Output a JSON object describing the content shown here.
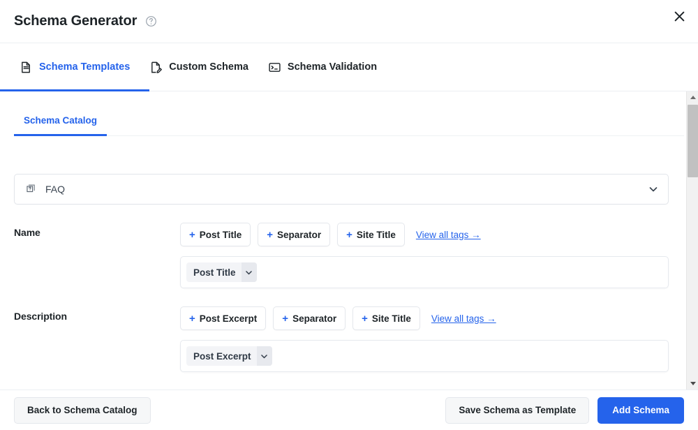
{
  "header": {
    "title": "Schema Generator",
    "help_icon": "question-circle-icon",
    "close_icon": "close-icon"
  },
  "tabs": [
    {
      "label": "Schema Templates",
      "icon": "document-lines-icon",
      "active": true
    },
    {
      "label": "Custom Schema",
      "icon": "document-pencil-icon",
      "active": false
    },
    {
      "label": "Schema Validation",
      "icon": "terminal-icon",
      "active": false
    }
  ],
  "subtabs": [
    {
      "label": "Schema Catalog",
      "active": true
    }
  ],
  "schema_type_select": {
    "value": "FAQ",
    "icon": "faq-card-icon",
    "chevron": "chevron-down-icon"
  },
  "fields": [
    {
      "label": "Name",
      "tag_buttons": [
        "Post Title",
        "Separator",
        "Site Title"
      ],
      "view_all_label": "View all tags →",
      "tokens": [
        {
          "label": "Post Title",
          "chevron": "chevron-down-icon"
        }
      ]
    },
    {
      "label": "Description",
      "tag_buttons": [
        "Post Excerpt",
        "Separator",
        "Site Title"
      ],
      "view_all_label": "View all tags →",
      "tokens": [
        {
          "label": "Post Excerpt",
          "chevron": "chevron-down-icon"
        }
      ]
    }
  ],
  "footer": {
    "back_label": "Back to Schema Catalog",
    "save_label": "Save Schema as Template",
    "add_label": "Add Schema"
  },
  "scrollbar": {
    "up_icon": "triangle-up-icon",
    "down_icon": "triangle-down-icon"
  },
  "colors": {
    "accent": "#2563eb",
    "text": "#1d2327",
    "border": "#e4e7ec",
    "chip_bg": "#f3f4f7"
  }
}
